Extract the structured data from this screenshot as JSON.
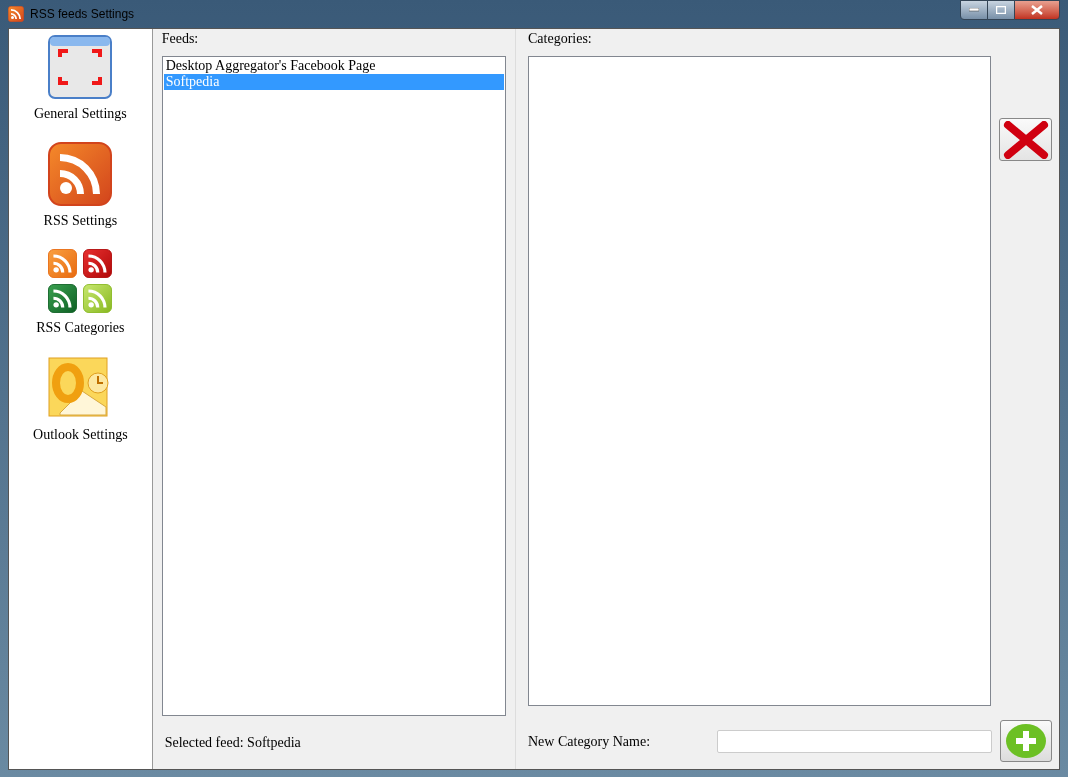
{
  "window": {
    "title": "RSS feeds Settings"
  },
  "sidebar": {
    "items": [
      {
        "label": "General Settings",
        "kind": "general"
      },
      {
        "label": "RSS Settings",
        "kind": "rss"
      },
      {
        "label": "RSS Categories",
        "kind": "categories"
      },
      {
        "label": "Outlook Settings",
        "kind": "outlook"
      }
    ]
  },
  "feeds": {
    "label": "Feeds:",
    "items": [
      {
        "label": "Desktop Aggregator's Facebook Page",
        "selected": false
      },
      {
        "label": "Softpedia",
        "selected": true
      }
    ],
    "selected_feed": "Selected feed: Softpedia"
  },
  "categories": {
    "label": "Categories:",
    "new_category_label": "New Category Name:"
  }
}
